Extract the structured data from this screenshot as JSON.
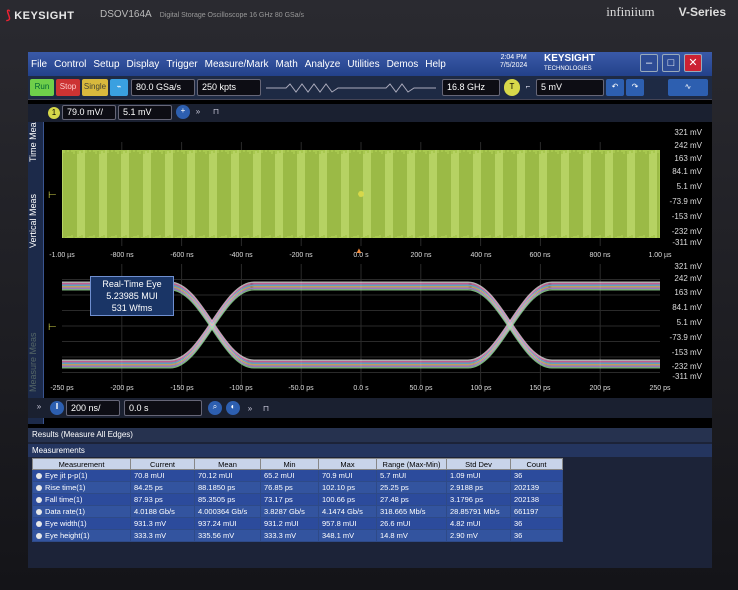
{
  "brand": {
    "left": "KEYSIGHT",
    "model": "DSOV164A",
    "model_desc": "Digital Storage Oscilloscope 16 GHz 80 GSa/s",
    "right_logo": "infiniium",
    "right_series": "V-Series"
  },
  "menu": [
    "File",
    "Control",
    "Setup",
    "Display",
    "Trigger",
    "Measure/Mark",
    "Math",
    "Analyze",
    "Utilities",
    "Demos",
    "Help"
  ],
  "clock": {
    "time": "2:04 PM",
    "date": "7/5/2024"
  },
  "keysight_logo": {
    "name": "KEYSIGHT",
    "sub": "TECHNOLOGIES"
  },
  "toolbar": {
    "run": "Run",
    "stop": "Stop",
    "single": "Single",
    "sample_rate": "80.0 GSa/s",
    "memory": "250 kpts",
    "bandwidth": "16.8 GHz",
    "trigger_level": "5 mV"
  },
  "vertical": {
    "channel": "1",
    "scale": "79.0 mV/",
    "offset": "5.1 mV"
  },
  "side_tabs": [
    "Time Meas",
    "Vertical Meas",
    "Measure Meas"
  ],
  "scale_top": [
    "321 mV",
    "242 mV",
    "163 mV",
    "84.1 mV",
    "5.1 mV",
    "-73.9 mV",
    "-153 mV",
    "-232 mV",
    "-311 mV"
  ],
  "scale_bottom": [
    "321 mV",
    "242 mV",
    "163 mV",
    "84.1 mV",
    "5.1 mV",
    "-73.9 mV",
    "-153 mV",
    "-232 mV",
    "-311 mV"
  ],
  "time_axis_top": [
    "-1.00 µs",
    "-800 ns",
    "-600 ns",
    "-400 ns",
    "-200 ns",
    "0.0 s",
    "200 ns",
    "400 ns",
    "600 ns",
    "800 ns",
    "1.00 µs"
  ],
  "time_axis_bottom": [
    "-250 ps",
    "-200 ps",
    "-150 ps",
    "-100 ps",
    "-50.0 ps",
    "0.0 s",
    "50.0 ps",
    "100 ps",
    "150 ps",
    "200 ps",
    "250 ps"
  ],
  "eye_label": {
    "title": "Real-Time Eye",
    "mui": "5.23985 MUI",
    "wfms": "531 Wfms"
  },
  "horizontal": {
    "scale": "200 ns/",
    "position": "0.0 s"
  },
  "results": {
    "title": "Results (Measure All Edges)",
    "panel": "Measurements",
    "columns": [
      "Measurement",
      "Current",
      "Mean",
      "Min",
      "Max",
      "Range (Max-Min)",
      "Std Dev",
      "Count"
    ],
    "rows": [
      [
        "Eye jit p-p(1)",
        "70.8 mUI",
        "70.12 mUI",
        "65.2 mUI",
        "70.9 mUI",
        "5.7 mUI",
        "1.09 mUI",
        "36"
      ],
      [
        "Rise time(1)",
        "84.25 ps",
        "88.1850 ps",
        "76.85 ps",
        "102.10 ps",
        "25.25 ps",
        "2.9188 ps",
        "202139"
      ],
      [
        "Fall time(1)",
        "87.93 ps",
        "85.3505 ps",
        "73.17 ps",
        "100.66 ps",
        "27.48 ps",
        "3.1796 ps",
        "202138"
      ],
      [
        "Data rate(1)",
        "4.0188 Gb/s",
        "4.000364 Gb/s",
        "3.8287 Gb/s",
        "4.1474 Gb/s",
        "318.665 Mb/s",
        "28.85791 Mb/s",
        "661197"
      ],
      [
        "Eye width(1)",
        "931.3 mV",
        "937.24 mUI",
        "931.2 mUI",
        "957.8 mUI",
        "26.6 mUI",
        "4.82 mUI",
        "36"
      ],
      [
        "Eye height(1)",
        "333.3 mV",
        "335.56 mV",
        "333.3 mV",
        "348.1 mV",
        "14.8 mV",
        "2.90 mV",
        "36"
      ]
    ]
  }
}
